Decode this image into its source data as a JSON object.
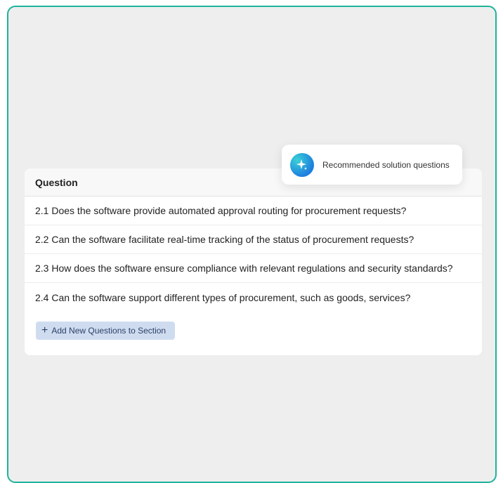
{
  "table": {
    "header": "Question",
    "rows": [
      {
        "text": "2.1 Does the software provide automated approval routing for procurement requests?"
      },
      {
        "text": "2.2 Can the software facilitate real-time tracking of the status of procurement requests?"
      },
      {
        "text": "2.3 How does the software ensure compliance with relevant regulations and security standards?"
      },
      {
        "text": "2.4 Can the software support different types of procurement, such as goods, services?"
      }
    ],
    "add_button": {
      "icon": "plus-icon",
      "label": "Add New Questions to Section"
    }
  },
  "popup": {
    "icon": "sparkle-icon",
    "label": "Recommended solution questions"
  },
  "colors": {
    "frame_border": "#1fb39b",
    "background": "#eeeeee",
    "button_bg": "#cfdcf0",
    "button_text": "#2d3f66",
    "sparkle_gradient_start": "#3ad1d6",
    "sparkle_gradient_end": "#1c7fe0"
  }
}
